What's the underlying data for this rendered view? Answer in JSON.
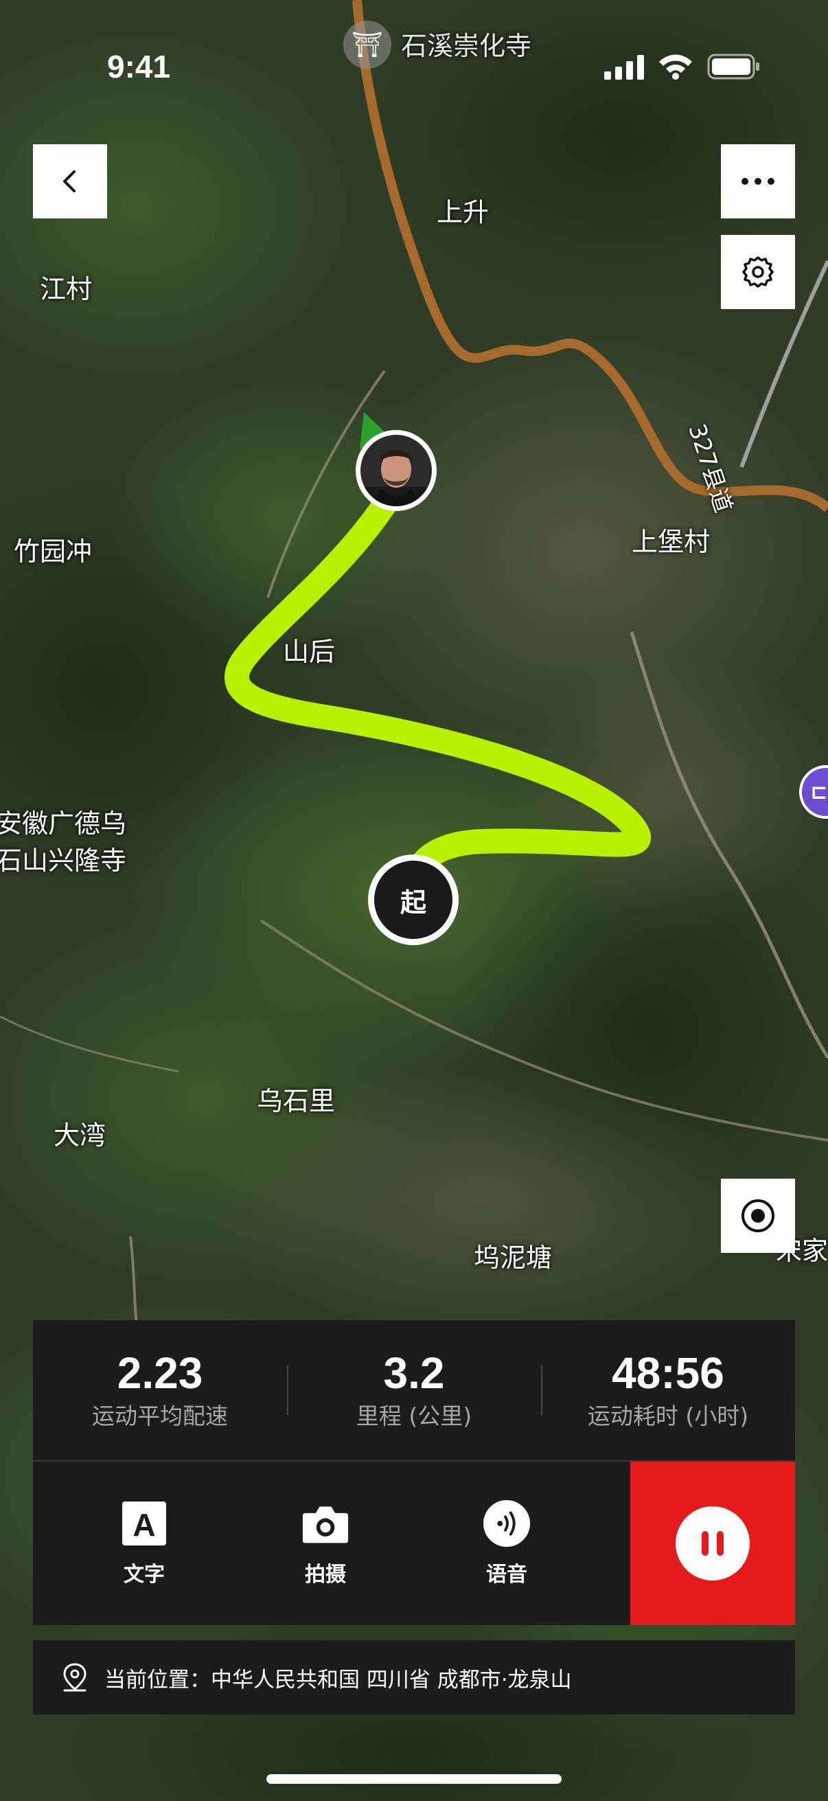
{
  "status_bar": {
    "time": "9:41"
  },
  "map": {
    "type": "satellite",
    "route_color": "#b8f000",
    "road_color": "#a66a2c",
    "places": [
      {
        "key": "temple",
        "label": "石溪崇化寺"
      },
      {
        "key": "shangsheng",
        "label": "上升"
      },
      {
        "key": "jiangcun",
        "label": "江村"
      },
      {
        "key": "zhuyuanchong",
        "label": "竹园冲"
      },
      {
        "key": "shanhou",
        "label": "山后"
      },
      {
        "key": "shangbaocun",
        "label": "上堡村"
      },
      {
        "key": "road327",
        "label": "327县道"
      },
      {
        "key": "anhui_line1",
        "label": "安徽广德乌"
      },
      {
        "key": "anhui_line2",
        "label": "石山兴隆寺"
      },
      {
        "key": "wushili",
        "label": "乌石里"
      },
      {
        "key": "dawan",
        "label": "大湾"
      },
      {
        "key": "wunitang",
        "label": "坞泥塘"
      },
      {
        "key": "songjia",
        "label": "宋家"
      }
    ],
    "start_marker_label": "起"
  },
  "icons": {
    "back": "chevron-left-icon",
    "more": "more-dots-icon",
    "settings": "gear-icon",
    "locate": "locate-icon",
    "text": "text-a-icon",
    "camera": "camera-icon",
    "voice": "voice-icon",
    "pause": "pause-icon",
    "location": "location-pin-icon",
    "temple": "temple-icon",
    "hotel": "hotel-icon",
    "avatar": "user-avatar"
  },
  "stats": [
    {
      "value": "2.23",
      "label": "运动平均配速"
    },
    {
      "value": "3.2",
      "label": "里程 (公里)"
    },
    {
      "value": "48:56",
      "label": "运动耗时 (小时)"
    }
  ],
  "actions": {
    "text_label": "文字",
    "photo_label": "拍摄",
    "voice_label": "语音"
  },
  "pause_color": "#e51b1b",
  "location": {
    "text": "当前位置：中华人民共和国 四川省 成都市·龙泉山"
  }
}
